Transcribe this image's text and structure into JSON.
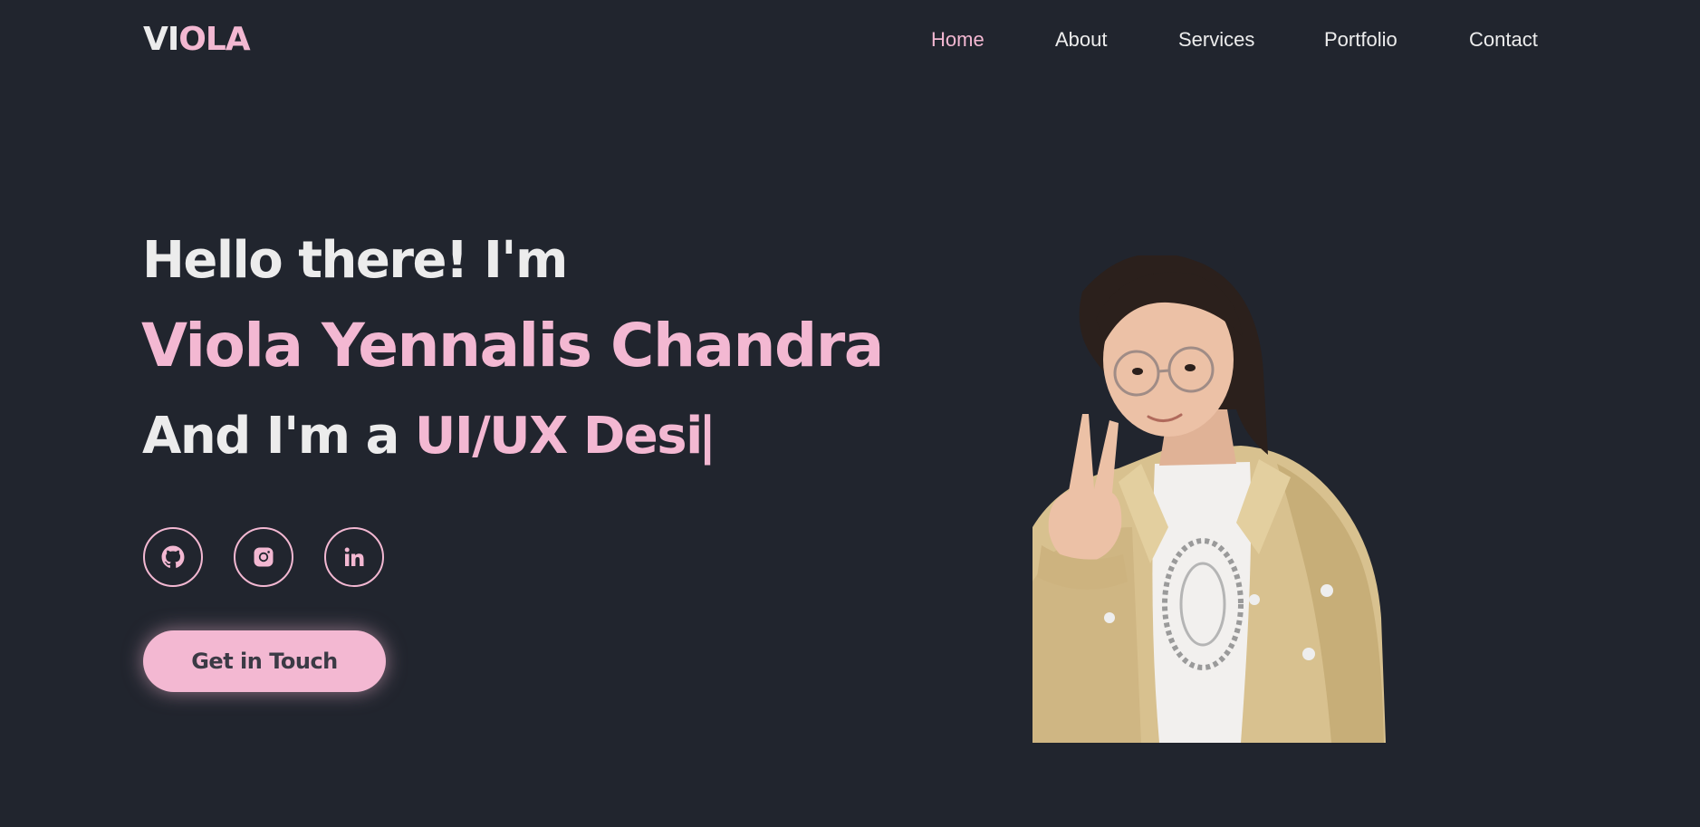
{
  "brand": {
    "logo_part1": "VI",
    "logo_part2": "OLA"
  },
  "nav": {
    "items": [
      {
        "label": "Home",
        "active": true
      },
      {
        "label": "About",
        "active": false
      },
      {
        "label": "Services",
        "active": false
      },
      {
        "label": "Portfolio",
        "active": false
      },
      {
        "label": "Contact",
        "active": false
      }
    ]
  },
  "hero": {
    "greeting": "Hello there! I'm",
    "name": "Viola Yennalis Chandra",
    "role_prefix": "And I'm a ",
    "role_typed": "UI/UX Desi",
    "cursor": "|",
    "cta_label": "Get in Touch"
  },
  "social": [
    {
      "icon": "github-icon"
    },
    {
      "icon": "instagram-icon"
    },
    {
      "icon": "linkedin-icon"
    }
  ],
  "colors": {
    "background": "#21252e",
    "accent": "#f3b8d2",
    "text": "#ececec",
    "button_text": "#3b3a45"
  }
}
